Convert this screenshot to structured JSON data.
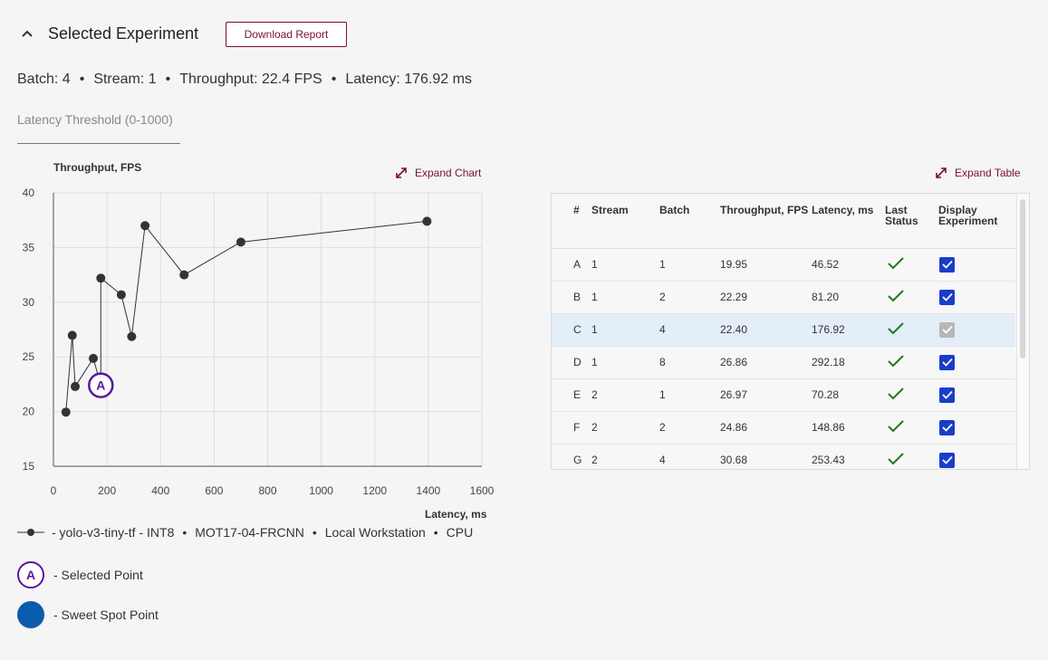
{
  "header": {
    "title": "Selected Experiment",
    "download_label": "Download Report"
  },
  "summary": {
    "batch": "Batch: 4",
    "stream": "Stream: 1",
    "throughput": "Throughput: 22.4 FPS",
    "latency": "Latency: 176.92 ms",
    "separator": "•"
  },
  "threshold": {
    "placeholder": "Latency Threshold (0-1000)",
    "value": ""
  },
  "expand_chart_label": "Expand Chart",
  "expand_table_label": "Expand Table",
  "chart_data": {
    "type": "line",
    "xlabel": "Latency, ms",
    "ylabel": "Throughput, FPS",
    "xlim": [
      0,
      1600
    ],
    "ylim": [
      15,
      40
    ],
    "xticks": [
      0,
      200,
      400,
      600,
      800,
      1000,
      1200,
      1400,
      1600
    ],
    "yticks": [
      15,
      20,
      25,
      30,
      35,
      40
    ],
    "grid": true,
    "series": [
      {
        "points": [
          [
            46.52,
            19.95
          ],
          [
            70.28,
            26.97
          ],
          [
            81.2,
            22.29
          ],
          [
            148.86,
            24.86
          ],
          [
            176.92,
            22.4
          ],
          [
            176.92,
            32.2
          ],
          [
            253.43,
            30.68
          ],
          [
            292.18,
            26.86
          ],
          [
            342,
            37.0
          ],
          [
            488,
            32.5
          ],
          [
            700,
            35.5
          ],
          [
            1395,
            37.4
          ]
        ]
      }
    ],
    "selected_point": {
      "x": 176.92,
      "y": 22.4,
      "label": "A"
    }
  },
  "legend": {
    "model": "- yolo-v3-tiny-tf - INT8",
    "dataset": "MOT17-04-FRCNN",
    "target": "Local Workstation",
    "device": "CPU",
    "separator": "•",
    "selected_label": "A",
    "selected_text": "- Selected Point",
    "sweet_text": "- Sweet Spot Point"
  },
  "table": {
    "headers": [
      "#",
      "Stream",
      "Batch",
      "Throughput, FPS",
      "Latency, ms",
      "Last Status",
      "Display Experiment"
    ],
    "rows": [
      {
        "id": "A",
        "stream": "1",
        "batch": "1",
        "throughput": "19.95",
        "latency": "46.52",
        "selected": false
      },
      {
        "id": "B",
        "stream": "1",
        "batch": "2",
        "throughput": "22.29",
        "latency": "81.20",
        "selected": false
      },
      {
        "id": "C",
        "stream": "1",
        "batch": "4",
        "throughput": "22.40",
        "latency": "176.92",
        "selected": true
      },
      {
        "id": "D",
        "stream": "1",
        "batch": "8",
        "throughput": "26.86",
        "latency": "292.18",
        "selected": false
      },
      {
        "id": "E",
        "stream": "2",
        "batch": "1",
        "throughput": "26.97",
        "latency": "70.28",
        "selected": false
      },
      {
        "id": "F",
        "stream": "2",
        "batch": "2",
        "throughput": "24.86",
        "latency": "148.86",
        "selected": false
      },
      {
        "id": "G",
        "stream": "2",
        "batch": "4",
        "throughput": "30.68",
        "latency": "253.43",
        "selected": false
      }
    ]
  },
  "colors": {
    "accent": "#7a0f3a",
    "selected_ring": "#5a189a",
    "sweet_spot": "#0b5cad",
    "checkbox": "#1a3dc8",
    "status_ok": "#1e7a1e"
  }
}
